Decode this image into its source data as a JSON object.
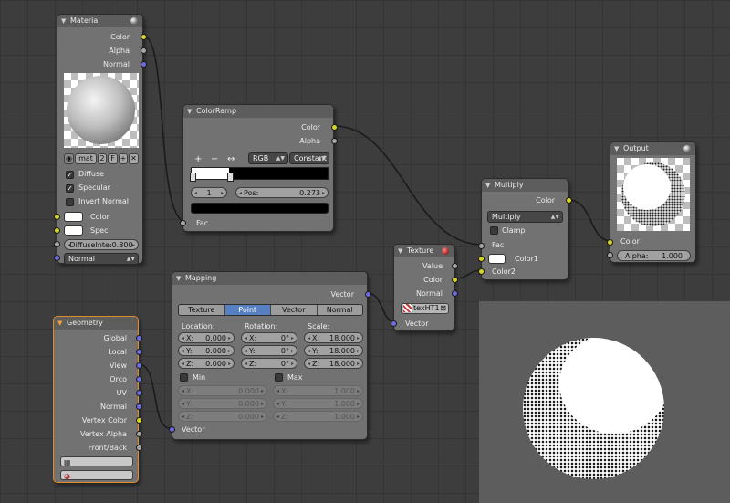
{
  "material": {
    "title": "Material",
    "outputs": [
      "Color",
      "Alpha",
      "Normal"
    ],
    "mat_name": "mat",
    "users": "2",
    "fake_user": "F",
    "diffuse_label": "Diffuse",
    "specular_label": "Specular",
    "invert_normal_label": "Invert Normal",
    "color_label": "Color",
    "spec_label": "Spec",
    "diffuse_intensity": "DiffuseInte:0.800",
    "normal_select": "Normal"
  },
  "colorramp": {
    "title": "ColorRamp",
    "outputs": [
      "Color",
      "Alpha"
    ],
    "plus": "+",
    "minus": "−",
    "flip": "↔",
    "color_mode": "RGB",
    "interpolation": "Constant",
    "active_stop": "1",
    "pos_label": "Pos:",
    "pos_value": "0.273",
    "input": "Fac"
  },
  "texture": {
    "title": "Texture",
    "outputs": [
      "Value",
      "Color",
      "Normal"
    ],
    "tex_name": "texHT1",
    "input": "Vector"
  },
  "multiply": {
    "title": "Multiply",
    "output": "Color",
    "blend_mode": "Multiply",
    "clamp_label": "Clamp",
    "inputs": [
      "Fac",
      "Color1",
      "Color2"
    ]
  },
  "output": {
    "title": "Output",
    "inputs": [
      "Color"
    ],
    "alpha_label": "Alpha:",
    "alpha_value": "1.000"
  },
  "mapping": {
    "title": "Mapping",
    "output": "Vector",
    "tabs": [
      "Texture",
      "Point",
      "Vector",
      "Normal"
    ],
    "active_tab": "Point",
    "location_label": "Location:",
    "rotation_label": "Rotation:",
    "scale_label": "Scale:",
    "location": [
      {
        "axis": "X:",
        "value": "0.000"
      },
      {
        "axis": "Y:",
        "value": "0.000"
      },
      {
        "axis": "Z:",
        "value": "0.000"
      }
    ],
    "rotation": [
      {
        "axis": "X:",
        "value": "0°"
      },
      {
        "axis": "Y:",
        "value": "0°"
      },
      {
        "axis": "Z:",
        "value": "0°"
      }
    ],
    "scale": [
      {
        "axis": "X:",
        "value": "18.000"
      },
      {
        "axis": "Y:",
        "value": "18.000"
      },
      {
        "axis": "Z:",
        "value": "18.000"
      }
    ],
    "min_label": "Min",
    "max_label": "Max",
    "min": [
      {
        "axis": "X:",
        "value": "0.000"
      },
      {
        "axis": "Y:",
        "value": "0.000"
      },
      {
        "axis": "Z:",
        "value": "0.000"
      }
    ],
    "max": [
      {
        "axis": "X:",
        "value": "1.000"
      },
      {
        "axis": "Y:",
        "value": "1.000"
      },
      {
        "axis": "Z:",
        "value": "1.000"
      }
    ],
    "input": "Vector"
  },
  "geometry": {
    "title": "Geometry",
    "outputs": [
      "Global",
      "Local",
      "View",
      "Orco",
      "UV",
      "Normal",
      "Vertex Color",
      "Vertex Alpha",
      "Front/Back"
    ]
  },
  "colors": {
    "socket_color": "#d8d328",
    "socket_float": "#a6a6a6",
    "socket_vector": "#6c6ce0",
    "active_tab": "#5680c2",
    "node_bg": "#727272",
    "active_node_border": "#e08c2b"
  }
}
